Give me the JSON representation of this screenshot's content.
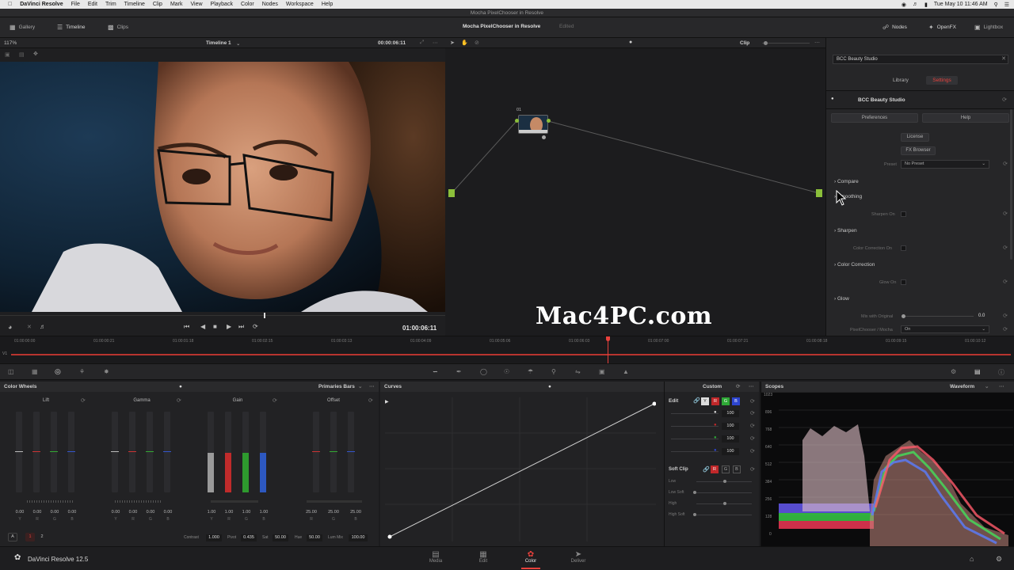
{
  "menubar": {
    "app": "DaVinci Resolve",
    "items": [
      "File",
      "Edit",
      "Trim",
      "Timeline",
      "Clip",
      "Mark",
      "View",
      "Playback",
      "Color",
      "Nodes",
      "Workspace",
      "Help"
    ],
    "clock": "Tue May 10  11:46 AM"
  },
  "window": {
    "title": "Mocha PixelChooser in Resolve"
  },
  "toolbar": {
    "gallery": "Gallery",
    "timeline": "Timeline",
    "clips": "Clips",
    "project": "Mocha PixelChooser in Resolve",
    "status": "Edited",
    "nodes": "Nodes",
    "openfx": "OpenFX",
    "lightbox": "Lightbox"
  },
  "viewer": {
    "zoom": "117%",
    "timeline_name": "Timeline 1",
    "timecode_top": "00:00:06:11",
    "timecode_bottom": "01:00:06:11"
  },
  "node_editor": {
    "mode": "Clip",
    "node_label": "01"
  },
  "openfx": {
    "search": "BCC Beauty Studio",
    "tab_library": "Library",
    "tab_settings": "Settings",
    "plugin_name": "BCC Beauty Studio",
    "preferences": "Preferences",
    "help": "Help",
    "license": "License",
    "fx_browser": "FX Browser",
    "preset_label": "Preset",
    "preset_value": "No Preset",
    "groups": [
      {
        "name": "Compare",
        "sub": ""
      },
      {
        "name": "Smoothing",
        "sub": "Sharpen On"
      },
      {
        "name": "Sharpen",
        "sub": "Color Correction On"
      },
      {
        "name": "Color Correction",
        "sub": "Glow On"
      },
      {
        "name": "Glow",
        "sub": "Mix with Original"
      }
    ],
    "mix_value": "0.0",
    "pixelchooser_label": "PixelChooser / Mocha",
    "pixelchooser_value": "On"
  },
  "timeline": {
    "track": "V1",
    "ticks": [
      "01:00:00:00",
      "01:00:00:21",
      "01:00:01:18",
      "01:00:02:15",
      "01:00:03:13",
      "01:00:04:09",
      "01:00:05:06",
      "01:00:06:03",
      "01:00:07:00",
      "01:00:07:21",
      "01:00:08:18",
      "01:00:09:15",
      "01:00:10:12"
    ]
  },
  "color_wheels": {
    "title": "Color Wheels",
    "mode": "Primaries Bars",
    "wheels": [
      {
        "name": "Lift",
        "values": [
          "0.00",
          "0.00",
          "0.00",
          "0.00"
        ]
      },
      {
        "name": "Gamma",
        "values": [
          "0.00",
          "0.00",
          "0.00",
          "0.00"
        ]
      },
      {
        "name": "Gain",
        "values": [
          "1.00",
          "1.00",
          "1.00",
          "1.00"
        ]
      },
      {
        "name": "Offset",
        "values": [
          "25.00",
          "25.00",
          "25.00"
        ]
      }
    ],
    "channels": [
      "Y",
      "R",
      "G",
      "B"
    ],
    "pages": [
      "A",
      "1",
      "2"
    ],
    "contrast_label": "Contrast",
    "contrast": "1.000",
    "pivot_label": "Pivot",
    "pivot": "0.435",
    "sat_label": "Sat",
    "sat": "50.00",
    "hue_label": "Hue",
    "hue": "50.00",
    "lummix_label": "Lum Mix",
    "lummix": "100.00"
  },
  "curves": {
    "title": "Curves",
    "mode": "Custom"
  },
  "edit": {
    "title": "Edit",
    "channels": [
      "Y",
      "R",
      "G",
      "B"
    ],
    "values": [
      "100",
      "100",
      "100",
      "100"
    ],
    "softclip": "Soft Clip",
    "softclip_rows": [
      "Low",
      "Low Soft",
      "High",
      "High Soft"
    ]
  },
  "scopes": {
    "title": "Scopes",
    "mode": "Waveform",
    "scale": [
      "1023",
      "896",
      "768",
      "640",
      "512",
      "384",
      "256",
      "128",
      "0"
    ]
  },
  "bottombar": {
    "product": "DaVinci Resolve 12.5",
    "tabs": [
      "Media",
      "Edit",
      "Color",
      "Deliver"
    ],
    "active": "Color"
  },
  "watermark": "Mac4PC.com",
  "colors": {
    "accent": "#e8413c",
    "active_tab": "#e8413c"
  }
}
